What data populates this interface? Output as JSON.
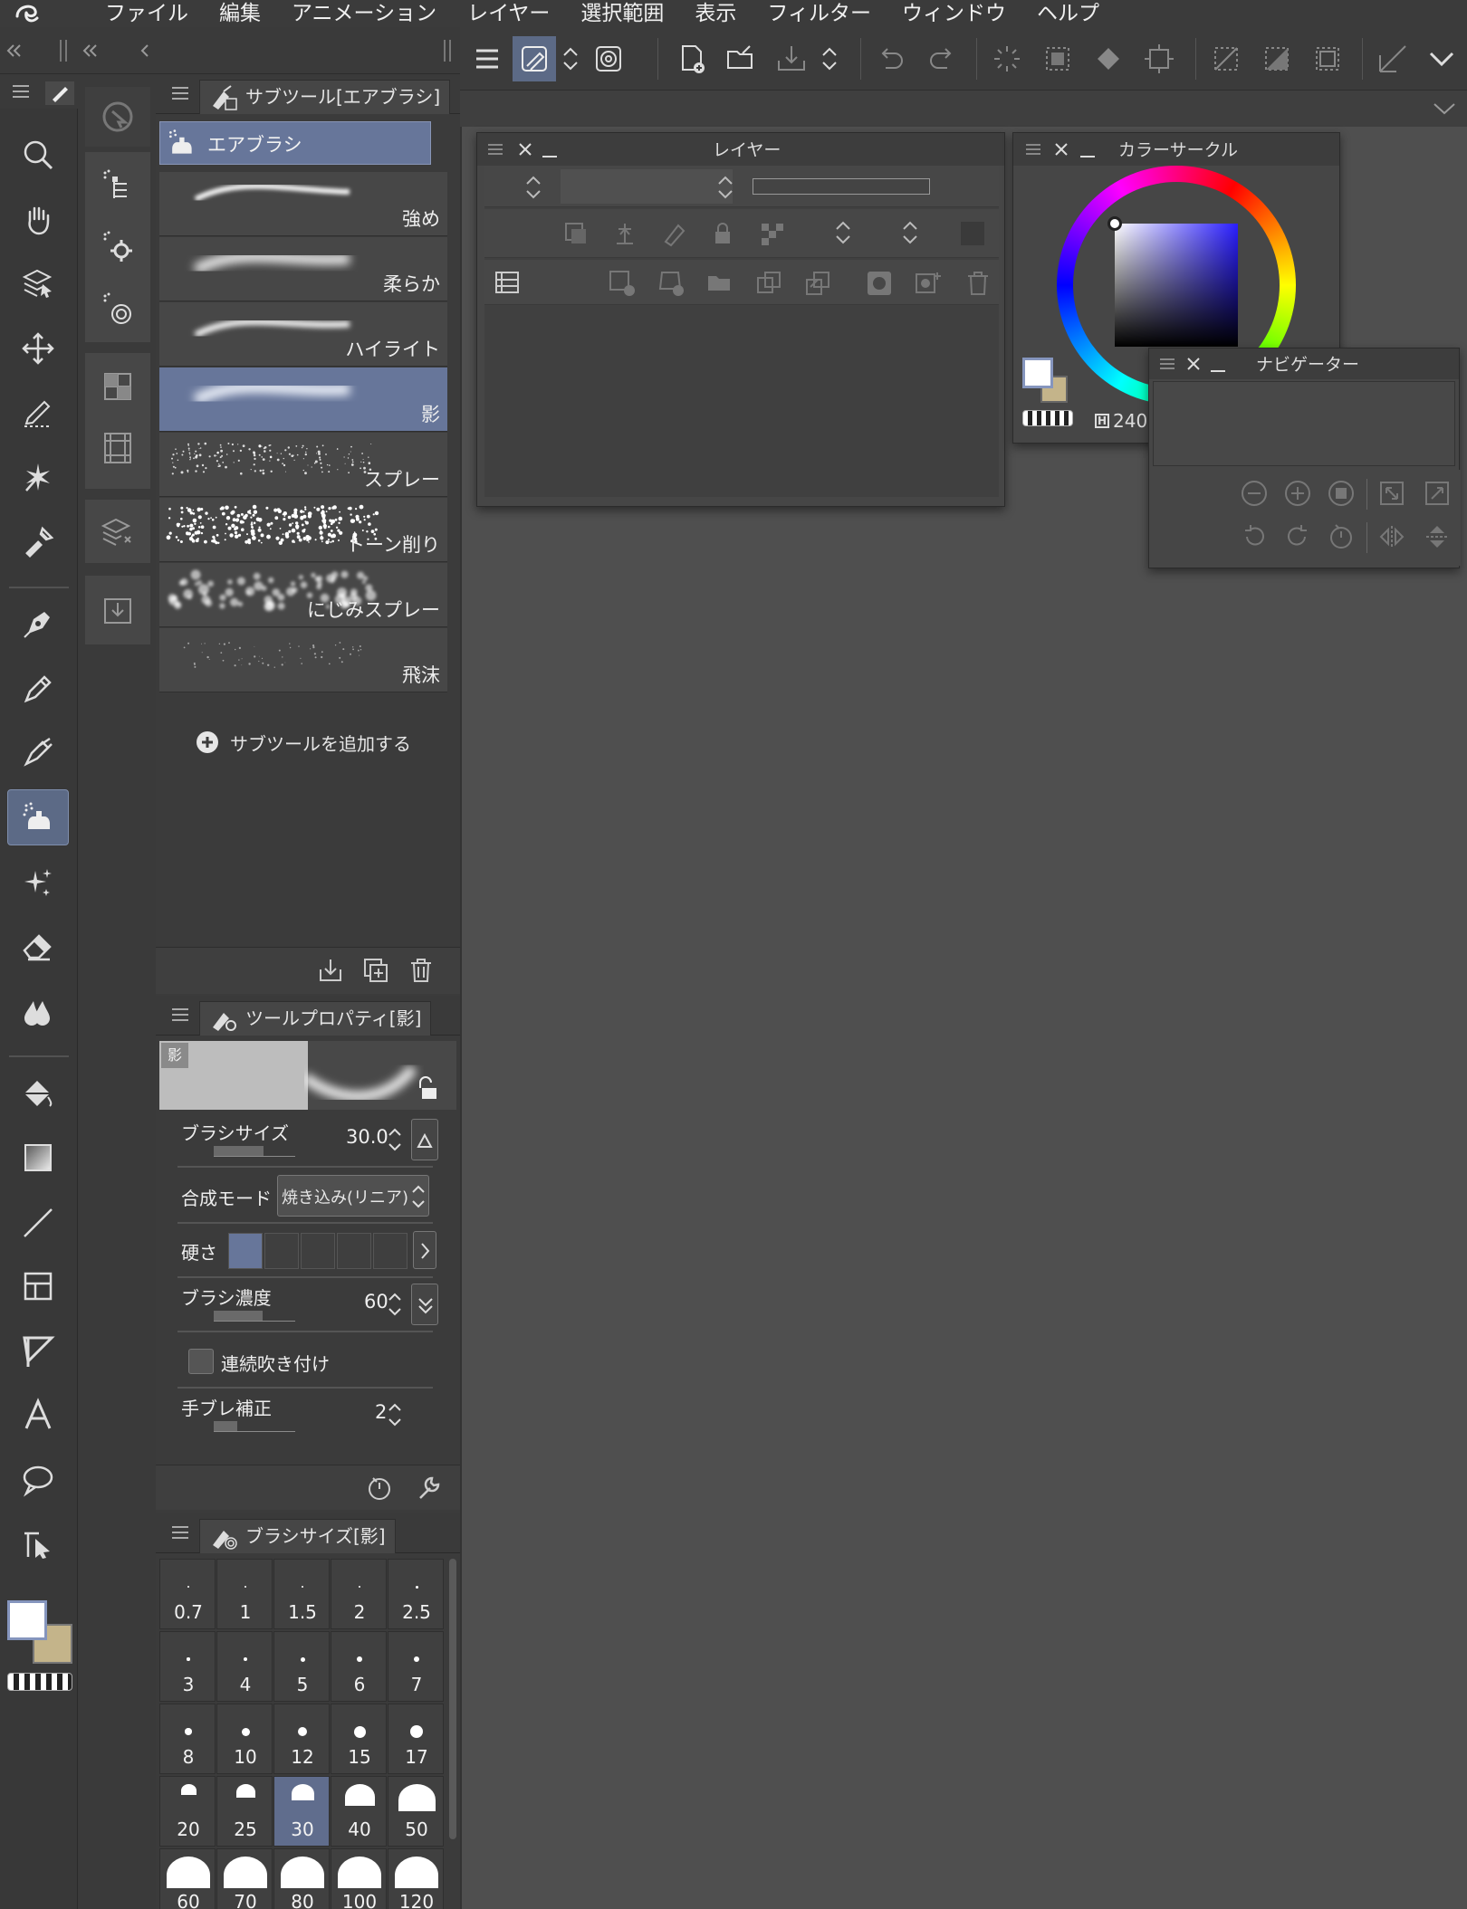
{
  "menu": [
    "ファイル",
    "編集",
    "アニメーション",
    "レイヤー",
    "選択範囲",
    "表示",
    "フィルター",
    "ウィンドウ",
    "ヘルプ"
  ],
  "subtool": {
    "tab_label": "サブツール[エアブラシ]",
    "group_label": "エアブラシ",
    "items": [
      {
        "label": "強め",
        "stroke": "strong"
      },
      {
        "label": "柔らか",
        "stroke": "soft"
      },
      {
        "label": "ハイライト",
        "stroke": "highlight"
      },
      {
        "label": "影",
        "stroke": "shadow",
        "selected": true
      },
      {
        "label": "スプレー",
        "stroke": "spray"
      },
      {
        "label": "トーン削り",
        "stroke": "tone"
      },
      {
        "label": "にじみスプレー",
        "stroke": "blur"
      },
      {
        "label": "飛沫",
        "stroke": "splash"
      }
    ],
    "add_label": "サブツールを追加する"
  },
  "tool_property": {
    "tab_label": "ツールプロパティ[影]",
    "preview_badge": "影",
    "brush_size_label": "ブラシサイズ",
    "brush_size_value": "30.0",
    "blend_mode_label": "合成モード",
    "blend_mode_value": "焼き込み(リニア)",
    "hardness_label": "硬さ",
    "hardness_level": 1,
    "density_label": "ブラシ濃度",
    "density_value": "60",
    "continuous_label": "連続吹き付け",
    "continuous_checked": false,
    "stabilization_label": "手ブレ補正",
    "stabilization_value": "2"
  },
  "brush_size": {
    "tab_label": "ブラシサイズ[影]",
    "sizes": [
      "0.7",
      "1",
      "1.5",
      "2",
      "2.5",
      "3",
      "4",
      "5",
      "6",
      "7",
      "8",
      "10",
      "12",
      "15",
      "17",
      "20",
      "25",
      "30",
      "40",
      "50",
      "60",
      "70",
      "80",
      "100",
      "120"
    ],
    "selected": "30"
  },
  "layer_panel": {
    "title": "レイヤー"
  },
  "color_panel": {
    "title": "カラーサークル",
    "hue_label": "H",
    "hue_value": "240"
  },
  "navigator_panel": {
    "title": "ナビゲーター"
  },
  "colors": {
    "main": "#ffffff",
    "sub": "#c4b48a",
    "accent": "#5c6a86"
  }
}
